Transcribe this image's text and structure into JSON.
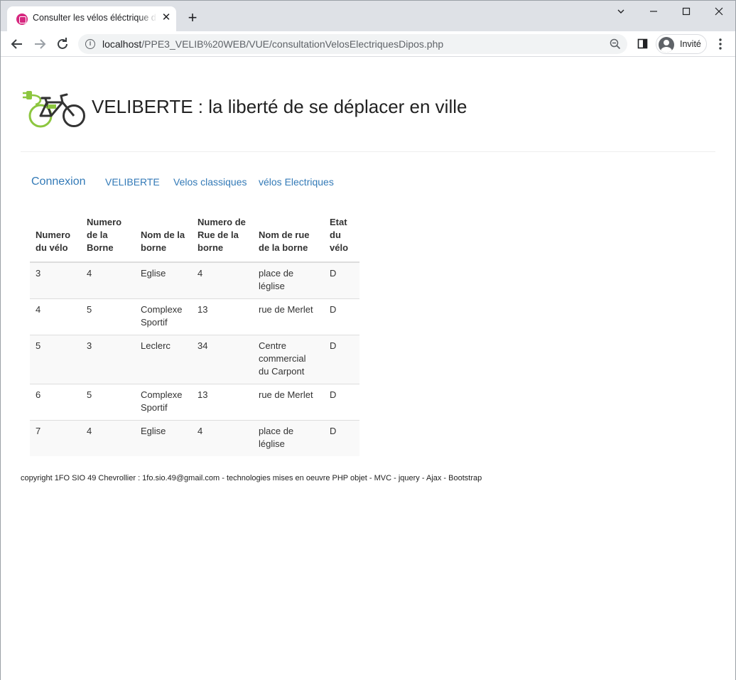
{
  "browser": {
    "tab_title": "Consulter les vélos éléctrique disponibles",
    "url_host": "localhost",
    "url_path": "/PPE3_VELIB%20WEB/VUE/consultationVelosElectriquesDipos.php",
    "profile_label": "Invité"
  },
  "header": {
    "title": "VELIBERTE : la liberté de se déplacer en ville",
    "logo_icon": "electric-bike-icon"
  },
  "nav": {
    "connexion": "Connexion",
    "veliberte": "VELIBERTE",
    "classiques": "Velos classiques",
    "electriques": "vélos Electriques"
  },
  "table": {
    "headers": [
      "Numero du vélo",
      "Numero de la Borne",
      "Nom de la borne",
      "Numero de Rue de la borne",
      "Nom de rue de la borne",
      "Etat du vélo"
    ],
    "rows": [
      [
        "3",
        "4",
        "Eglise",
        "4",
        "place de léglise",
        "D"
      ],
      [
        "4",
        "5",
        "Complexe Sportif",
        "13",
        "rue de Merlet",
        "D"
      ],
      [
        "5",
        "3",
        "Leclerc",
        "34",
        "Centre commercial du Carpont",
        "D"
      ],
      [
        "6",
        "5",
        "Complexe Sportif",
        "13",
        "rue de Merlet",
        "D"
      ],
      [
        "7",
        "4",
        "Eglise",
        "4",
        "place de léglise",
        "D"
      ]
    ]
  },
  "footer": {
    "text": "copyright 1FO SIO 49 Chevrollier : 1fo.sio.49@gmail.com - technologies mises en oeuvre PHP objet - MVC - jquery - Ajax - Bootstrap"
  },
  "colors": {
    "link": "#337ab7",
    "logo_green": "#8cc63f",
    "favicon": "#d6277f"
  }
}
